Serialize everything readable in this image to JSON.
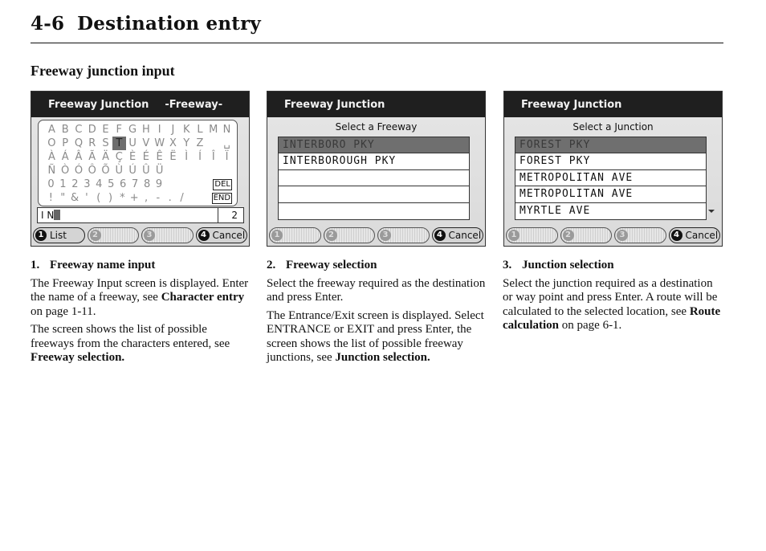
{
  "page": {
    "section_number": "4-6",
    "title": "Destination entry",
    "heading": "Freeway junction input"
  },
  "screens": [
    {
      "header": "Freeway Junction",
      "header_sub": "-Freeway-",
      "keyboard_rows": [
        [
          "A",
          "B",
          "C",
          "D",
          "E",
          "F",
          "G",
          "H",
          "I",
          "J",
          "K",
          "L",
          "M",
          "N"
        ],
        [
          "O",
          "P",
          "Q",
          "R",
          "S",
          "T",
          "U",
          "V",
          "W",
          "X",
          "Y",
          "Z",
          "",
          "␣"
        ],
        [
          "À",
          "Á",
          "Â",
          "Ã",
          "Ä",
          "Ç",
          "È",
          "É",
          "Ê",
          "Ë",
          "Ì",
          "Í",
          "Î",
          "Ï"
        ],
        [
          "Ñ",
          "Ò",
          "Ó",
          "Ô",
          "Õ",
          "Ù",
          "Ú",
          "Û",
          "Ü",
          "",
          "",
          "",
          "",
          ""
        ],
        [
          "0",
          "1",
          "2",
          "3",
          "4",
          "5",
          "6",
          "7",
          "8",
          "9",
          "",
          "",
          "",
          ""
        ],
        [
          "!",
          "\"",
          "&",
          "'",
          "(",
          ")",
          "*",
          "+",
          ",",
          "-",
          ".",
          "/",
          "",
          ""
        ]
      ],
      "selected_key": "T",
      "special_keys": {
        "del": "DEL",
        "end": "END"
      },
      "entry_value": "I N",
      "match_count": "2",
      "buttons": [
        {
          "num": "1",
          "label": "List",
          "enabled": true
        },
        {
          "num": "2",
          "label": "",
          "enabled": false
        },
        {
          "num": "3",
          "label": "",
          "enabled": false
        },
        {
          "num": "4",
          "label": "Cancel",
          "enabled": true
        }
      ]
    },
    {
      "header": "Freeway Junction",
      "list_title": "Select a Freeway",
      "items": [
        "INTERBORO PKY",
        "INTERBOROUGH PKY",
        "",
        "",
        ""
      ],
      "selected_index": 0,
      "buttons": [
        {
          "num": "1",
          "label": "",
          "enabled": false
        },
        {
          "num": "2",
          "label": "",
          "enabled": false
        },
        {
          "num": "3",
          "label": "",
          "enabled": false
        },
        {
          "num": "4",
          "label": "Cancel",
          "enabled": true
        }
      ]
    },
    {
      "header": "Freeway Junction",
      "list_title": "Select a Junction",
      "items": [
        "FOREST PKY",
        "FOREST PKY",
        "METROPOLITAN AVE",
        "METROPOLITAN AVE",
        "MYRTLE AVE"
      ],
      "selected_index": 0,
      "has_more": true,
      "buttons": [
        {
          "num": "1",
          "label": "",
          "enabled": false
        },
        {
          "num": "2",
          "label": "",
          "enabled": false
        },
        {
          "num": "3",
          "label": "",
          "enabled": false
        },
        {
          "num": "4",
          "label": "Cancel",
          "enabled": true
        }
      ]
    }
  ],
  "captions": [
    {
      "number": "1.",
      "title": "Freeway name input",
      "paragraphs": [
        [
          {
            "t": "The Freeway Input screen is displayed. Enter the name of a freeway, see "
          },
          {
            "t": "Character entry",
            "b": true
          },
          {
            "t": " on page 1-11."
          }
        ],
        [
          {
            "t": "The screen shows the list of possible freeways from the characters entered, see "
          },
          {
            "t": "Freeway selection.",
            "b": true
          }
        ]
      ]
    },
    {
      "number": "2.",
      "title": "Freeway selection",
      "paragraphs": [
        [
          {
            "t": "Select the freeway required as the destination and press Enter."
          }
        ],
        [
          {
            "t": "The Entrance/Exit screen is displayed. Select ENTRANCE or EXIT and press Enter, the screen shows the list of possible freeway junctions, see "
          },
          {
            "t": "Junction selection.",
            "b": true
          }
        ]
      ]
    },
    {
      "number": "3.",
      "title": "Junction selection",
      "paragraphs": [
        [
          {
            "t": "Select the junction required as a destination or way point and press Enter. A route will be calculated to the selected location, see "
          },
          {
            "t": "Route calculation",
            "b": true
          },
          {
            "t": " on page 6-1."
          }
        ]
      ]
    }
  ]
}
